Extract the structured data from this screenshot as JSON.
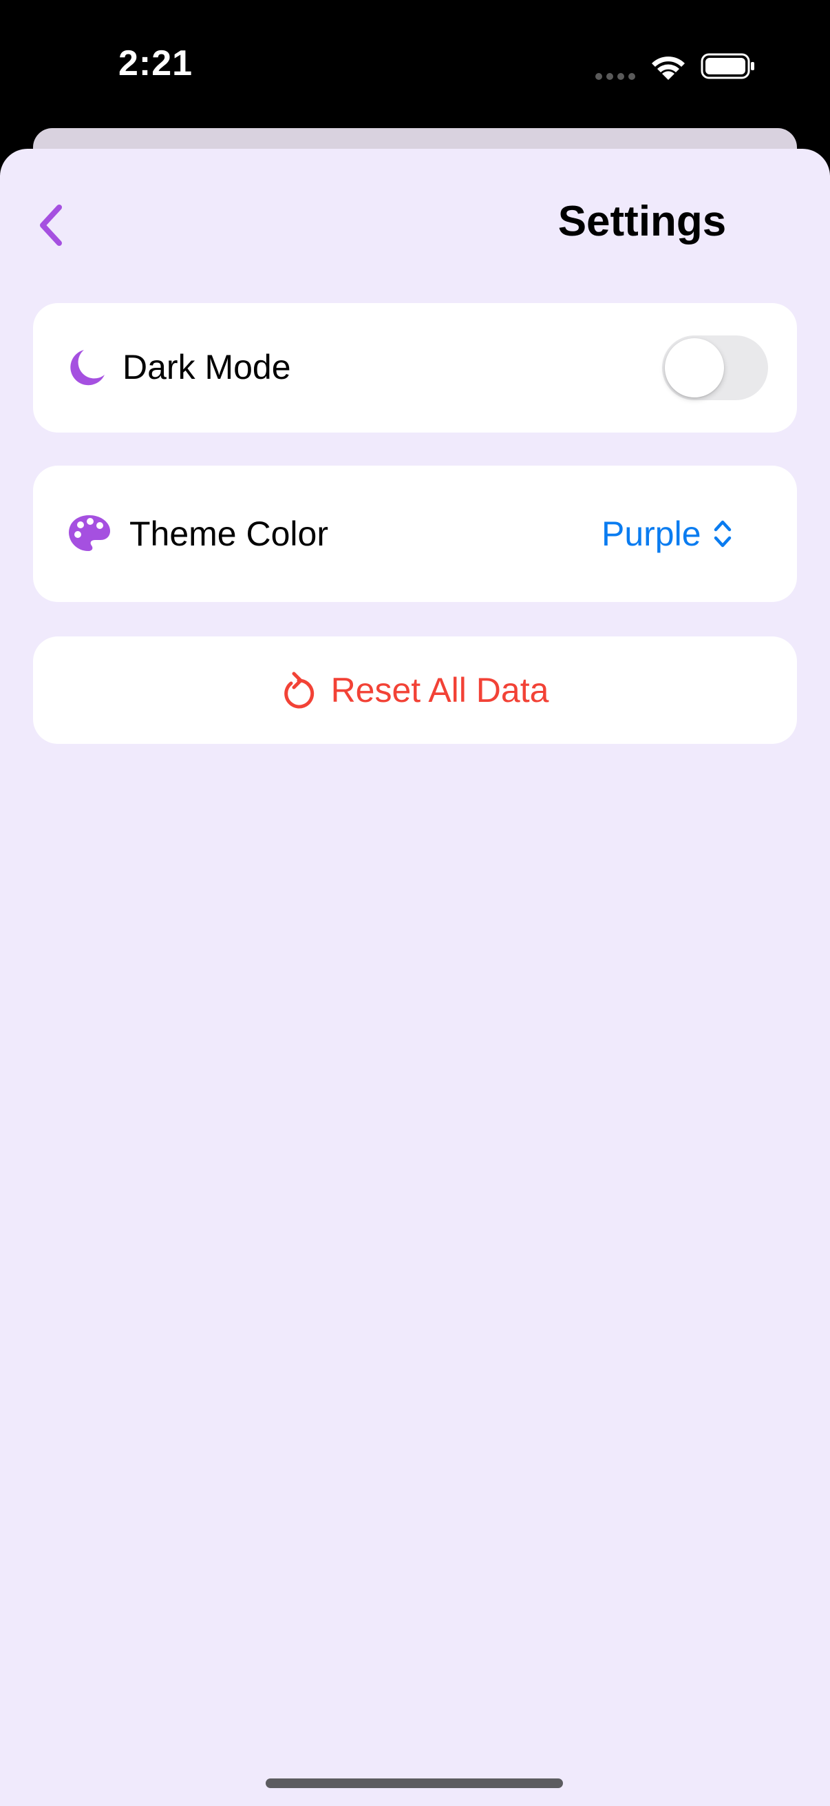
{
  "status_bar": {
    "time": "2:21"
  },
  "nav": {
    "title": "Settings",
    "back_icon": "chevron-left-icon"
  },
  "settings": {
    "dark_mode": {
      "label": "Dark Mode",
      "icon": "moon-icon",
      "enabled": false
    },
    "theme_color": {
      "label": "Theme Color",
      "icon": "palette-icon",
      "value": "Purple"
    },
    "reset": {
      "label": "Reset All Data",
      "icon": "reset-icon"
    }
  },
  "colors": {
    "accent_purple": "#a550e0",
    "sheet_background": "#f0eafc",
    "picker_blue": "#0a7cf0",
    "destructive_red": "#f24236",
    "toggle_off": "#e9e9eb"
  }
}
